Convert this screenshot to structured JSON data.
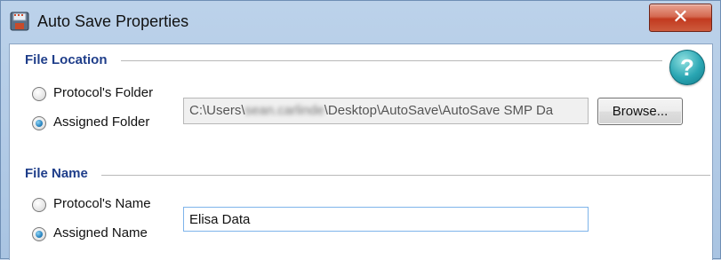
{
  "window": {
    "title": "Auto Save Properties",
    "close_label": "✕"
  },
  "help": {
    "label": "?"
  },
  "file_location": {
    "title": "File Location",
    "options": [
      {
        "label": "Protocol's Folder",
        "checked": false
      },
      {
        "label": "Assigned Folder",
        "checked": true
      }
    ],
    "path_prefix": "C:\\Users\\",
    "path_obscured": "sean.carlinde",
    "path_suffix": "\\Desktop\\AutoSave\\AutoSave SMP Da",
    "browse_label": "Browse..."
  },
  "file_name": {
    "title": "File Name",
    "options": [
      {
        "label": "Protocol's Name",
        "checked": false
      },
      {
        "label": "Assigned Name",
        "checked": true
      }
    ],
    "value": "Elisa Data"
  },
  "colors": {
    "group_title": "#1f3e8a",
    "close_button": "#c23a1f",
    "help_button": "#2aa6b3",
    "radio_selected": "#1b79b8"
  }
}
